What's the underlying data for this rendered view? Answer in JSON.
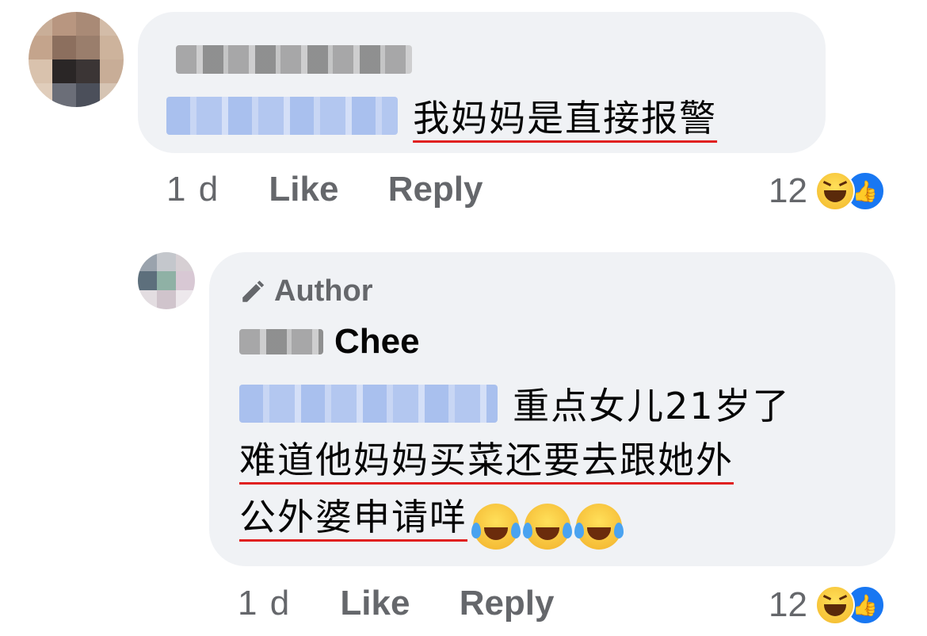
{
  "comment1": {
    "author_name_blurred": "",
    "mention_blurred": "",
    "text": "我妈妈是直接报警",
    "time": "1 d",
    "like_label": "Like",
    "reply_label": "Reply",
    "reaction_count": "12"
  },
  "comment2": {
    "badge": "Author",
    "author_name_visible": "Chee",
    "text_line1": "重点女儿21岁了",
    "text_line2": "难道他妈妈买菜还要去跟她外",
    "text_line3": "公外婆申请咩",
    "emoji_count": 3,
    "time": "1 d",
    "like_label": "Like",
    "reply_label": "Reply",
    "reaction_count": "12"
  },
  "colors": {
    "bubble": "#f0f2f5",
    "meta_text": "#65676b",
    "like_blue": "#1877f2",
    "underline_red": "#e02020"
  },
  "icons": [
    "haha-icon",
    "like-icon",
    "pencil-icon",
    "tears-of-joy-emoji"
  ]
}
